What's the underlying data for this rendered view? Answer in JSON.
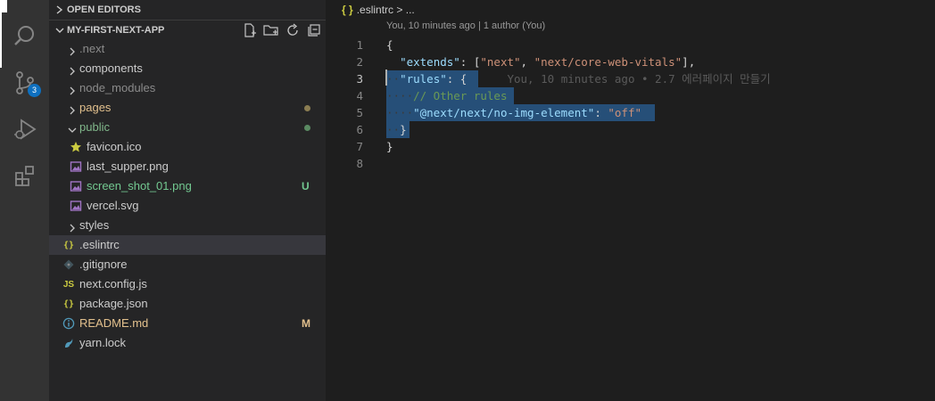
{
  "activity_bar": {
    "icons": [
      "search-icon",
      "source-control-icon",
      "run-debug-icon",
      "extensions-icon"
    ],
    "scm_badge": "3"
  },
  "sidebar": {
    "open_editors_label": "OPEN EDITORS",
    "project_label": "MY-FIRST-NEXT-APP",
    "tree": [
      {
        "label": ".next",
        "kind": "folder",
        "open": false,
        "color": "#8b8b8b"
      },
      {
        "label": "components",
        "kind": "folder",
        "open": false,
        "color": "#cccccc"
      },
      {
        "label": "node_modules",
        "kind": "folder",
        "open": false,
        "color": "#8b8b8b"
      },
      {
        "label": "pages",
        "kind": "folder",
        "open": false,
        "color": "#e2c08d",
        "dot": "#8b7d52"
      },
      {
        "label": "public",
        "kind": "folder",
        "open": true,
        "color": "#81b88b",
        "dot": "#5a8a62"
      },
      {
        "label": "favicon.ico",
        "kind": "file",
        "icon": "star-icon",
        "color": "#cccccc"
      },
      {
        "label": "last_supper.png",
        "kind": "file",
        "icon": "image-icon",
        "color": "#cccccc"
      },
      {
        "label": "screen_shot_01.png",
        "kind": "file",
        "icon": "image-icon",
        "color": "#73c991",
        "status": "U"
      },
      {
        "label": "vercel.svg",
        "kind": "file",
        "icon": "image-icon",
        "color": "#cccccc"
      },
      {
        "label": "styles",
        "kind": "folder",
        "open": false,
        "color": "#cccccc"
      },
      {
        "label": ".eslintrc",
        "kind": "file",
        "icon": "json-icon",
        "color": "#cccccc",
        "selected": true
      },
      {
        "label": ".gitignore",
        "kind": "file",
        "icon": "git-icon",
        "color": "#cccccc"
      },
      {
        "label": "next.config.js",
        "kind": "file",
        "icon": "js-icon",
        "color": "#cccccc"
      },
      {
        "label": "package.json",
        "kind": "file",
        "icon": "json-icon",
        "color": "#cccccc"
      },
      {
        "label": "README.md",
        "kind": "file",
        "icon": "info-icon",
        "color": "#e2c08d",
        "status": "M"
      },
      {
        "label": "yarn.lock",
        "kind": "file",
        "icon": "yarn-icon",
        "color": "#cccccc"
      }
    ]
  },
  "editor": {
    "breadcrumb_icon": "{ }",
    "breadcrumb_file": ".eslintrc",
    "breadcrumb_sep": ">",
    "breadcrumb_tail": "...",
    "codelens": "You, 10 minutes ago | 1 author (You)",
    "line_numbers": [
      "1",
      "2",
      "3",
      "4",
      "5",
      "6",
      "7",
      "8"
    ],
    "lines": {
      "l1": "{",
      "l2_key": "\"extends\"",
      "l2_colon": ": [",
      "l2_v1": "\"next\"",
      "l2_comma": ", ",
      "l2_v2": "\"next/core-web-vitals\"",
      "l2_end": "],",
      "l3_key": "\"rules\"",
      "l3_rest": ": {",
      "l3_blame": "You, 10 minutes ago • 2.7 에러페이지 만들기",
      "l4_comment": "// Other rules",
      "l5_key": "\"@next/next/no-img-element\"",
      "l5_colon": ": ",
      "l5_val": "\"off\"",
      "l6": "}",
      "l7": "}"
    }
  }
}
